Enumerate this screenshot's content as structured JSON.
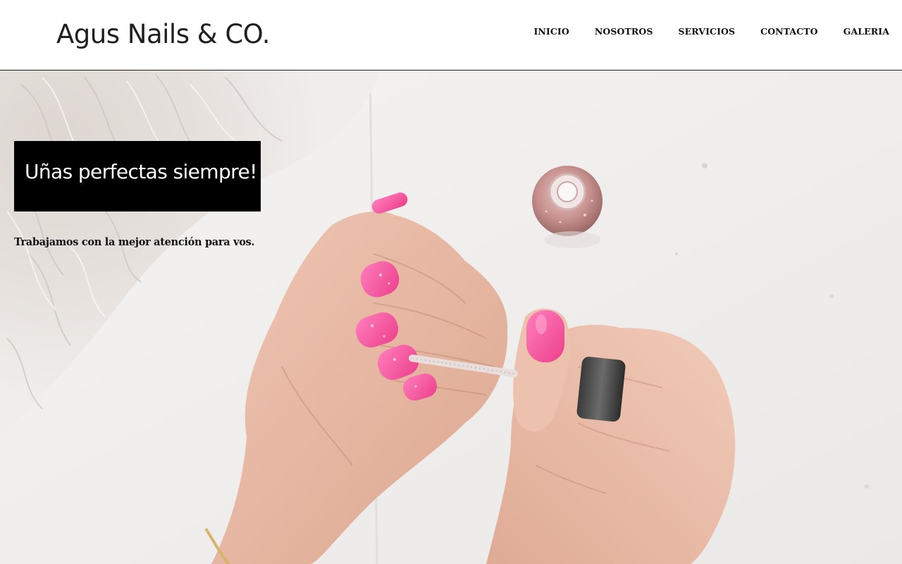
{
  "header": {
    "brand": "Agus Nails & CO.",
    "nav": [
      {
        "label": "INICIO"
      },
      {
        "label": "NOSOTROS"
      },
      {
        "label": "SERVICIOS"
      },
      {
        "label": "CONTACTO"
      },
      {
        "label": "GALERIA"
      }
    ]
  },
  "hero": {
    "headline": "Uñas perfectas siempre!",
    "tagline": "Trabajamos con la mejor atención para vos.",
    "image_subject": "hands-painting-pink-nail-polish-photo",
    "colors": {
      "nail_pink": "#f2529a",
      "skin": "#e9b9a6",
      "background": "#f1efee",
      "headline_box": "#000000"
    }
  }
}
